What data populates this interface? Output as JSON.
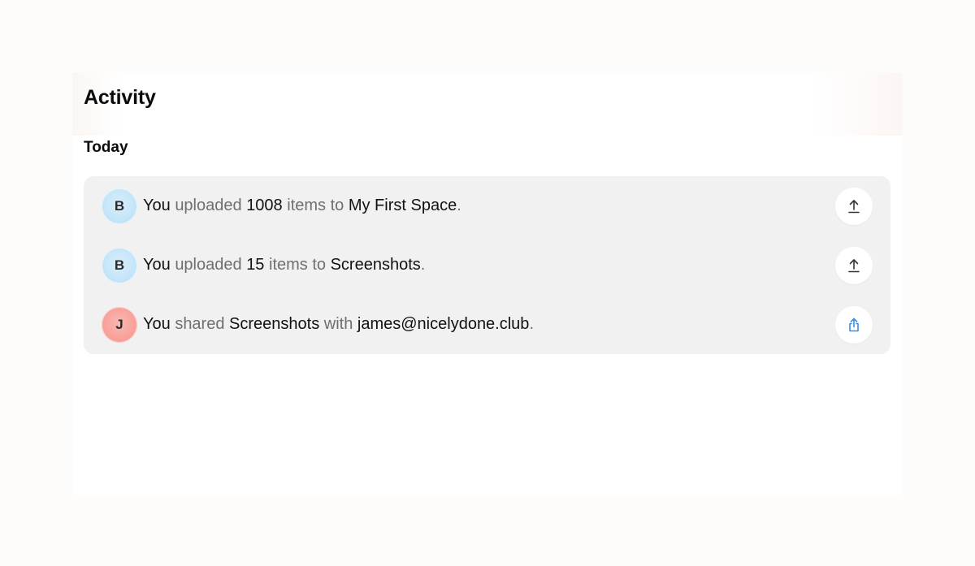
{
  "page": {
    "title": "Activity",
    "section": "Today"
  },
  "activities": [
    {
      "avatar_initial": "B",
      "avatar_color": "#c4e5f8",
      "actor": "You",
      "verb": "uploaded",
      "count": "1008",
      "middle": "items to",
      "target": "My First Space",
      "end": ".",
      "icon": "upload-icon"
    },
    {
      "avatar_initial": "B",
      "avatar_color": "#c4e5f8",
      "actor": "You",
      "verb": "uploaded",
      "count": "15",
      "middle": "items to",
      "target": "Screenshots",
      "end": ".",
      "icon": "upload-icon"
    },
    {
      "avatar_initial": "J",
      "avatar_color": "#f79f98",
      "actor": "You",
      "verb": "shared",
      "object": "Screenshots",
      "middle": "with",
      "target": "james@nicelydone.club",
      "end": ".",
      "icon": "share-icon",
      "icon_color": "#3a8ee6"
    }
  ]
}
